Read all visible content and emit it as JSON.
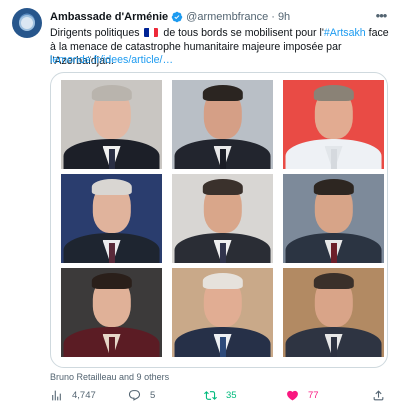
{
  "author": {
    "display_name": "Ambassade d'Arménie",
    "handle": "@armembfrance",
    "separator": "·",
    "time": "9h"
  },
  "tweet": {
    "text_part1": "Dirigents politiques",
    "text_part2": "de tous bords se mobilisent pour l'",
    "hashtag": "#Artsakh",
    "text_part3": "face à la menace de catastrophe humanitaire majeure imposée par l'Azerbaïdjan.",
    "link": "lemonde.fr/idees/article/…"
  },
  "media": {
    "caption": "Bruno Retailleau and 9 others",
    "photos": [
      {
        "bg": "#c9c6c2",
        "skin": "#e3b8a3",
        "hair": "#b9b4ad",
        "suit": "#1c1f28",
        "shirt": "#f1f1f1",
        "tie": "#2a2f44"
      },
      {
        "bg": "#b9bfc6",
        "skin": "#d59f86",
        "hair": "#2b2521",
        "suit": "#22252e",
        "shirt": "#e9e9e9",
        "tie": "#1b1d26"
      },
      {
        "bg": "#e94b45",
        "skin": "#e2ab91",
        "hair": "#8a8276",
        "suit": "#eef1f5",
        "shirt": "#e2e6ea",
        "tie": "#d5d9de"
      },
      {
        "bg": "#2a3d6e",
        "skin": "#e0b39c",
        "hair": "#d9d6d2",
        "suit": "#1e2530",
        "shirt": "#ecedef",
        "tie": "#5a2a3a"
      },
      {
        "bg": "#d8d6d3",
        "skin": "#d9a68a",
        "hair": "#3a312c",
        "suit": "#2a2d35",
        "shirt": "#f0f0f0",
        "tie": "#31344c"
      },
      {
        "bg": "#7d8a9a",
        "skin": "#d7a488",
        "hair": "#2d2621",
        "suit": "#2b3442",
        "shirt": "#e8e8e8",
        "tie": "#6d1f29"
      },
      {
        "bg": "#3c3a3a",
        "skin": "#e0b198",
        "hair": "#2a1f1a",
        "suit": "#5b1c24",
        "shirt": "#e6d7c9",
        "tie": "#5b1c24"
      },
      {
        "bg": "#c9a989",
        "skin": "#e1ad93",
        "hair": "#e6e2dc",
        "suit": "#263048",
        "shirt": "#eef0f3",
        "tie": "#2d4a7a"
      },
      {
        "bg": "#b28a63",
        "skin": "#d9a488",
        "hair": "#3a302a",
        "suit": "#2e3442",
        "shirt": "#e7e7e7",
        "tie": "#2c3140"
      }
    ]
  },
  "actions": {
    "views": "4,747",
    "replies": "5",
    "retweets": "35",
    "likes": "77"
  },
  "colors": {
    "accent": "#1d9bf0",
    "retweet": "#00ba7c",
    "like": "#f91880",
    "muted": "#536471",
    "verified": "#1d9bf0"
  }
}
